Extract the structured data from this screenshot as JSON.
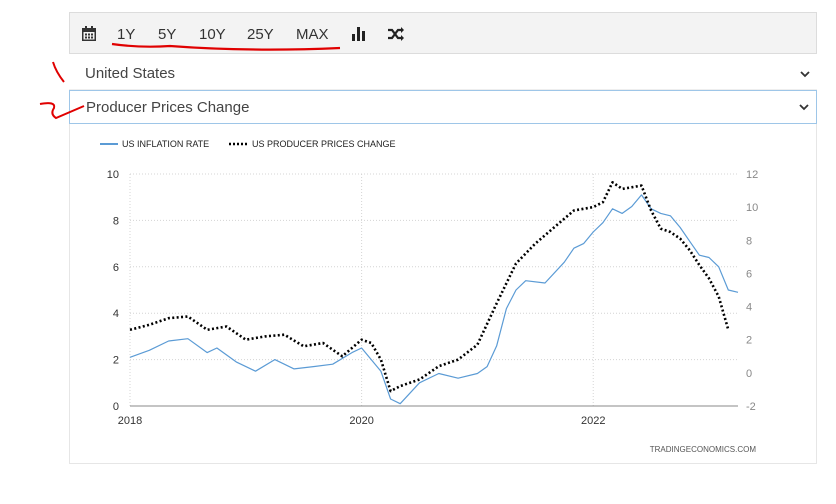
{
  "toolbar": {
    "items": [
      "1Y",
      "5Y",
      "10Y",
      "25Y",
      "MAX"
    ],
    "icons": [
      "calendar-icon",
      "bar-chart-icon",
      "shuffle-icon"
    ]
  },
  "selects": {
    "country": "United States",
    "indicator": "Producer Prices Change"
  },
  "colors": {
    "inflation": "#5b9bd5",
    "ppi": "#000000",
    "annotation": "#e00000"
  },
  "chart_data": {
    "type": "line",
    "credit": "TRADINGECONOMICS.COM",
    "legend_position": "top-left",
    "grid": true,
    "x_range": [
      "2018-01",
      "2023-04"
    ],
    "x_ticks": [
      "2018",
      "2020",
      "2022"
    ],
    "left_axis": {
      "range": [
        0,
        10
      ],
      "ticks": [
        "0",
        "2",
        "4",
        "6",
        "8",
        "10"
      ]
    },
    "right_axis": {
      "range": [
        -2,
        12
      ],
      "ticks": [
        "-2",
        "0",
        "2",
        "4",
        "6",
        "8",
        "10",
        "12"
      ]
    },
    "series": [
      {
        "name": "US INFLATION RATE",
        "axis": "left",
        "style": "solid",
        "x": [
          "2018-01",
          "2018-03",
          "2018-05",
          "2018-07",
          "2018-09",
          "2018-10",
          "2018-12",
          "2019-02",
          "2019-04",
          "2019-06",
          "2019-08",
          "2019-10",
          "2019-12",
          "2020-01",
          "2020-03",
          "2020-04",
          "2020-05",
          "2020-07",
          "2020-09",
          "2020-11",
          "2021-01",
          "2021-02",
          "2021-03",
          "2021-04",
          "2021-05",
          "2021-06",
          "2021-08",
          "2021-10",
          "2021-11",
          "2021-12",
          "2022-01",
          "2022-02",
          "2022-03",
          "2022-04",
          "2022-05",
          "2022-06",
          "2022-07",
          "2022-08",
          "2022-09",
          "2022-10",
          "2022-11",
          "2022-12",
          "2023-01",
          "2023-02",
          "2023-03",
          "2023-04"
        ],
        "values": [
          2.1,
          2.4,
          2.8,
          2.9,
          2.3,
          2.5,
          1.9,
          1.5,
          2.0,
          1.6,
          1.7,
          1.8,
          2.3,
          2.5,
          1.5,
          0.3,
          0.1,
          1.0,
          1.4,
          1.2,
          1.4,
          1.7,
          2.6,
          4.2,
          5.0,
          5.4,
          5.3,
          6.2,
          6.8,
          7.0,
          7.5,
          7.9,
          8.5,
          8.3,
          8.6,
          9.1,
          8.5,
          8.3,
          8.2,
          7.7,
          7.1,
          6.5,
          6.4,
          6.0,
          5.0,
          4.9
        ]
      },
      {
        "name": "US PRODUCER PRICES CHANGE",
        "axis": "right",
        "style": "dotted",
        "x": [
          "2018-01",
          "2018-03",
          "2018-05",
          "2018-07",
          "2018-09",
          "2018-11",
          "2019-01",
          "2019-03",
          "2019-05",
          "2019-07",
          "2019-09",
          "2019-11",
          "2020-01",
          "2020-02",
          "2020-03",
          "2020-04",
          "2020-05",
          "2020-07",
          "2020-09",
          "2020-11",
          "2021-01",
          "2021-03",
          "2021-05",
          "2021-07",
          "2021-09",
          "2021-11",
          "2022-01",
          "2022-02",
          "2022-03",
          "2022-04",
          "2022-06",
          "2022-07",
          "2022-08",
          "2022-09",
          "2022-10",
          "2022-11",
          "2022-12",
          "2023-01",
          "2023-02",
          "2023-03"
        ],
        "values": [
          2.6,
          2.9,
          3.3,
          3.4,
          2.6,
          2.8,
          2.0,
          2.2,
          2.3,
          1.6,
          1.8,
          1.0,
          2.0,
          1.8,
          0.8,
          -1.1,
          -0.8,
          -0.4,
          0.4,
          0.8,
          1.7,
          4.2,
          6.6,
          7.8,
          8.8,
          9.8,
          10.0,
          10.3,
          11.5,
          11.1,
          11.3,
          9.8,
          8.7,
          8.5,
          8.1,
          7.4,
          6.5,
          5.7,
          4.6,
          2.6
        ]
      }
    ]
  }
}
